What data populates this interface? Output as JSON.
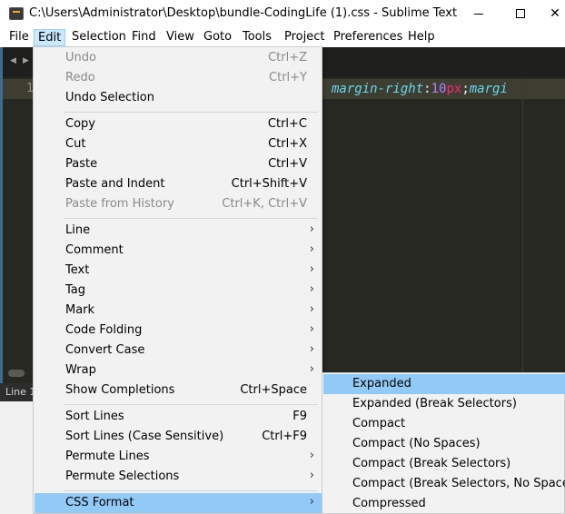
{
  "window": {
    "title": "C:\\Users\\Administrator\\Desktop\\bundle-CodingLife (1).css - Sublime Text",
    "close_glyph": "✕"
  },
  "menubar": {
    "items": [
      "File",
      "Edit",
      "Selection",
      "Find",
      "View",
      "Goto",
      "Tools",
      "Project",
      "Preferences",
      "Help"
    ],
    "active": "Edit"
  },
  "editor": {
    "line_number": "1",
    "code": {
      "p1": "margin-right",
      "c1": ":",
      "n1": "10",
      "u1": "px",
      "s1": ";",
      "p2": "margi"
    },
    "status": "Line 1"
  },
  "edit_menu": {
    "undo": {
      "label": "Undo",
      "shortcut": "Ctrl+Z"
    },
    "redo": {
      "label": "Redo",
      "shortcut": "Ctrl+Y"
    },
    "undo_selection": {
      "label": "Undo Selection"
    },
    "copy": {
      "label": "Copy",
      "shortcut": "Ctrl+C"
    },
    "cut": {
      "label": "Cut",
      "shortcut": "Ctrl+X"
    },
    "paste": {
      "label": "Paste",
      "shortcut": "Ctrl+V"
    },
    "paste_indent": {
      "label": "Paste and Indent",
      "shortcut": "Ctrl+Shift+V"
    },
    "paste_history": {
      "label": "Paste from History",
      "shortcut": "Ctrl+K, Ctrl+V"
    },
    "line": {
      "label": "Line"
    },
    "comment": {
      "label": "Comment"
    },
    "text": {
      "label": "Text"
    },
    "tag": {
      "label": "Tag"
    },
    "mark": {
      "label": "Mark"
    },
    "code_folding": {
      "label": "Code Folding"
    },
    "convert_case": {
      "label": "Convert Case"
    },
    "wrap": {
      "label": "Wrap"
    },
    "show_completions": {
      "label": "Show Completions",
      "shortcut": "Ctrl+Space"
    },
    "sort_lines": {
      "label": "Sort Lines",
      "shortcut": "F9"
    },
    "sort_lines_case": {
      "label": "Sort Lines (Case Sensitive)",
      "shortcut": "Ctrl+F9"
    },
    "permute_lines": {
      "label": "Permute Lines"
    },
    "permute_selections": {
      "label": "Permute Selections"
    },
    "css_format": {
      "label": "CSS Format"
    },
    "submenu_arrow": "›"
  },
  "css_format_submenu": {
    "items": [
      "Expanded",
      "Expanded (Break Selectors)",
      "Compact",
      "Compact (No Spaces)",
      "Compact (Break Selectors)",
      "Compact (Break Selectors, No Spaces)",
      "Compressed"
    ],
    "highlighted": "Expanded"
  },
  "colors": {
    "menu_highlight": "#91c9f7",
    "menubar_active": "#cce8ff",
    "editor_bg": "#272822"
  }
}
